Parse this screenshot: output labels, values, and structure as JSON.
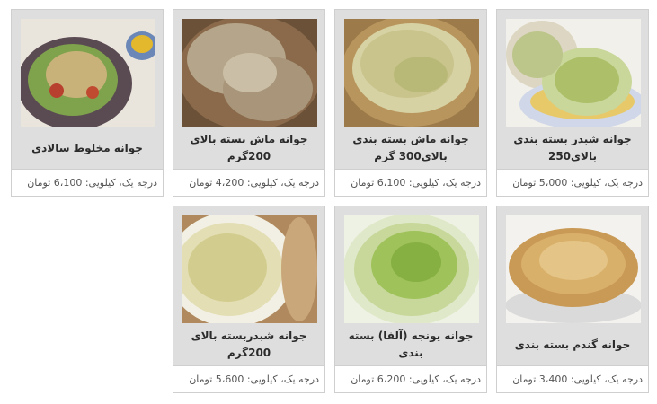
{
  "products": [
    {
      "title": "جوانه شبدر بسته بندی بالای250",
      "price": "درجه یک، کیلویی: 5،000 تومان",
      "image_icon": "clover-sprouts-in-bowl"
    },
    {
      "title": "جوانه ماش بسته بندی بالای300 گرم",
      "price": "درجه یک، کیلویی: 6،100 تومان",
      "image_icon": "mung-sprouts-in-basket"
    },
    {
      "title": "جوانه ماش بسته بالای 200گرم",
      "price": "درجه یک، کیلویی: 4،200 تومان",
      "image_icon": "mung-sprouts-pile"
    },
    {
      "title": "جوانه مخلوط سالادی",
      "price": "درجه یک، کیلویی: 6،100 تومان",
      "image_icon": "sprout-salad-plate"
    },
    {
      "title": "جوانه گندم بسته بندی",
      "price": "درجه یک، کیلویی: 3،400 تومان",
      "image_icon": "wheat-sprouts-plate"
    },
    {
      "title": "جوانه یونجه (آلفا) بسته بندی",
      "price": "درجه یک، کیلویی: 6،200 تومان",
      "image_icon": "alfalfa-sprouts-bowl"
    },
    {
      "title": "جوانه شبدربسته بالای 200گرم",
      "price": "درجه یک، کیلویی: 5،600 تومان",
      "image_icon": "clover-sprouts-bowl"
    }
  ]
}
